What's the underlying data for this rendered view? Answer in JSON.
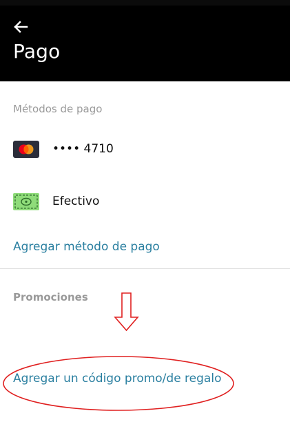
{
  "header": {
    "title": "Pago",
    "back_icon": "arrow-left-icon"
  },
  "payment_methods": {
    "section_label": "Métodos de pago",
    "items": [
      {
        "icon": "mastercard-icon",
        "label": "•••• 4710"
      },
      {
        "icon": "cash-icon",
        "label": "Efectivo"
      }
    ],
    "add_link": "Agregar método de pago"
  },
  "promotions": {
    "section_label": "Promociones",
    "add_code_link": "Agregar un código promo/de regalo"
  },
  "annotation": {
    "color": "#e02020",
    "arrow_icon": "down-arrow-annotation-icon",
    "shape": "ellipse-highlight"
  },
  "colors": {
    "header_bg": "#000000",
    "link": "#2a7fa0",
    "muted": "#9a9a9a",
    "cash_green": "#7ed26a"
  }
}
